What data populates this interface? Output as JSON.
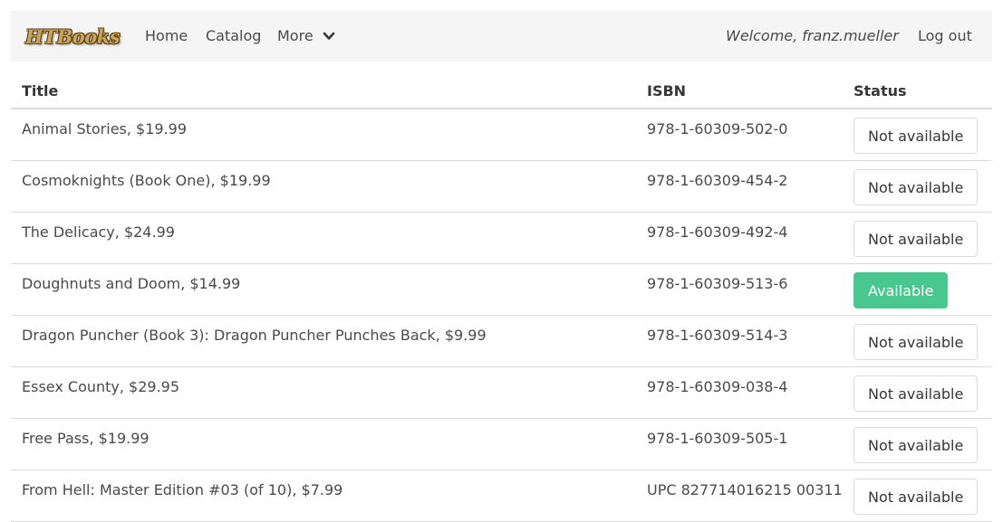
{
  "navbar": {
    "logo_text": "HTBooks",
    "links": {
      "home": "Home",
      "catalog": "Catalog",
      "more": "More"
    },
    "welcome": "Welcome, franz.mueller",
    "logout": "Log out"
  },
  "table": {
    "headers": {
      "title": "Title",
      "isbn": "ISBN",
      "status": "Status"
    },
    "rows": [
      {
        "title": "Animal Stories, $19.99",
        "isbn": "978-1-60309-502-0",
        "status": "Not available",
        "available": false
      },
      {
        "title": "Cosmoknights (Book One), $19.99",
        "isbn": "978-1-60309-454-2",
        "status": "Not available",
        "available": false
      },
      {
        "title": "The Delicacy, $24.99",
        "isbn": "978-1-60309-492-4",
        "status": "Not available",
        "available": false
      },
      {
        "title": "Doughnuts and Doom, $14.99",
        "isbn": "978-1-60309-513-6",
        "status": "Available",
        "available": true
      },
      {
        "title": "Dragon Puncher (Book 3): Dragon Puncher Punches Back, $9.99",
        "isbn": "978-1-60309-514-3",
        "status": "Not available",
        "available": false
      },
      {
        "title": "Essex County, $29.95",
        "isbn": "978-1-60309-038-4",
        "status": "Not available",
        "available": false
      },
      {
        "title": "Free Pass, $19.99",
        "isbn": "978-1-60309-505-1",
        "status": "Not available",
        "available": false
      },
      {
        "title": "From Hell: Master Edition #03 (of 10), $7.99",
        "isbn": "UPC 827714016215 00311",
        "status": "Not available",
        "available": false
      }
    ]
  },
  "colors": {
    "available": "#48c78e",
    "navbar_bg": "#f5f5f5",
    "border": "#dbdbdb"
  },
  "icons": {
    "more": "chevron-down-icon"
  }
}
